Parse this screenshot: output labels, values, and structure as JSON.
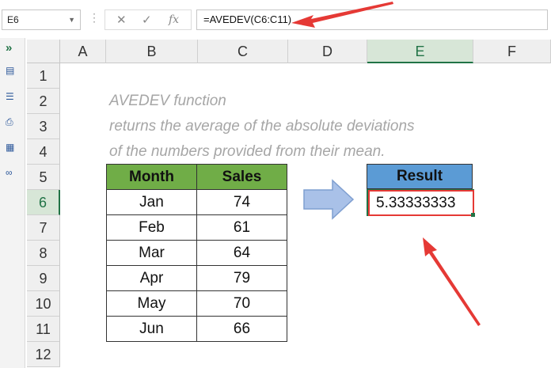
{
  "formula_bar": {
    "name_box": "E6",
    "cancel_icon": "✕",
    "enter_icon": "✓",
    "fx_label": "fx",
    "formula": "=AVEDEV(C6:C11)"
  },
  "sidebar": {
    "expand_icon": "»",
    "icons": [
      "table-icon",
      "list-icon",
      "print-icon",
      "grid-icon",
      "binoculars-icon"
    ]
  },
  "columns": [
    "A",
    "B",
    "C",
    "D",
    "E",
    "F"
  ],
  "rows": [
    "1",
    "2",
    "3",
    "4",
    "5",
    "6",
    "7",
    "8",
    "9",
    "10",
    "11",
    "12"
  ],
  "selected_cell": {
    "column": "E",
    "row": "6"
  },
  "note_lines": [
    "AVEDEV function",
    "returns the average of the absolute deviations",
    "of the numbers provided from their mean."
  ],
  "table": {
    "headers": [
      "Month",
      "Sales"
    ],
    "rows": [
      [
        "Jan",
        "74"
      ],
      [
        "Feb",
        "61"
      ],
      [
        "Mar",
        "64"
      ],
      [
        "Apr",
        "79"
      ],
      [
        "May",
        "70"
      ],
      [
        "Jun",
        "66"
      ]
    ]
  },
  "result": {
    "header": "Result",
    "value": "5.33333333"
  },
  "colors": {
    "month_sales_header": "#70ad47",
    "result_header": "#5b9bd5",
    "annotation_red": "#e53935",
    "selection_green": "#217346"
  }
}
